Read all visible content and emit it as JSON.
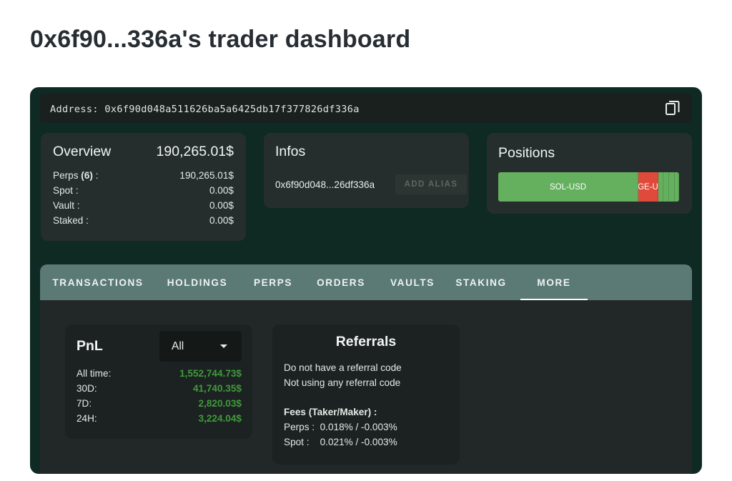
{
  "page": {
    "title": "0x6f90...336a's trader dashboard"
  },
  "address": {
    "label": "Address:",
    "value": "0x6f90d048a511626ba5a6425db17f377826df336a",
    "copy_icon": "copy-icon"
  },
  "overview": {
    "title": "Overview",
    "total": "190,265.01$",
    "rows": [
      {
        "label": "Perps",
        "count": "(6)",
        "suffix": ":",
        "value": "190,265.01$"
      },
      {
        "label": "Spot :",
        "value": "0.00$"
      },
      {
        "label": "Vault :",
        "value": "0.00$"
      },
      {
        "label": "Staked :",
        "value": "0.00$"
      }
    ]
  },
  "infos": {
    "title": "Infos",
    "address_short": "0x6f90d048...26df336a",
    "add_alias_label": "ADD ALIAS"
  },
  "positions": {
    "title": "Positions",
    "segments": [
      {
        "label": "SOL-USD",
        "share": 0.775,
        "color": "#64b05e"
      },
      {
        "label": "GE-U",
        "share": 0.11,
        "color": "#e04a3a"
      },
      {
        "label": "",
        "share": 0.03,
        "color": "#64b05e"
      },
      {
        "label": "",
        "share": 0.03,
        "color": "#64b05e"
      },
      {
        "label": "",
        "share": 0.03,
        "color": "#64b05e"
      },
      {
        "label": "",
        "share": 0.025,
        "color": "#64b05e"
      }
    ]
  },
  "tabs": [
    {
      "label": "TRANSACTIONS",
      "active": false
    },
    {
      "label": "HOLDINGS",
      "active": false
    },
    {
      "label": "PERPS",
      "active": false
    },
    {
      "label": "ORDERS",
      "active": false
    },
    {
      "label": "VAULTS",
      "active": false
    },
    {
      "label": "STAKING",
      "active": false
    },
    {
      "label": "MORE",
      "active": true
    }
  ],
  "pnl": {
    "title": "PnL",
    "period_select": "All",
    "rows": [
      {
        "label": "All time:",
        "value": "1,552,744.73$"
      },
      {
        "label": "30D:",
        "value": "41,740.35$"
      },
      {
        "label": "7D:",
        "value": "2,820.03$"
      },
      {
        "label": "24H:",
        "value": "3,224.04$"
      }
    ]
  },
  "referrals": {
    "title": "Referrals",
    "line1": "Do not have a referral code",
    "line2": "Not using any referral code",
    "fees_title": "Fees (Taker/Maker) :",
    "perps_fees": "Perps :  0.018% / -0.003%",
    "spot_fees": "Spot :    0.021% / -0.003%"
  },
  "colors": {
    "panel": "#0e2a23",
    "tabbar": "#5b7a76",
    "positive": "#3f9a3a",
    "long": "#64b05e",
    "short": "#e04a3a"
  }
}
